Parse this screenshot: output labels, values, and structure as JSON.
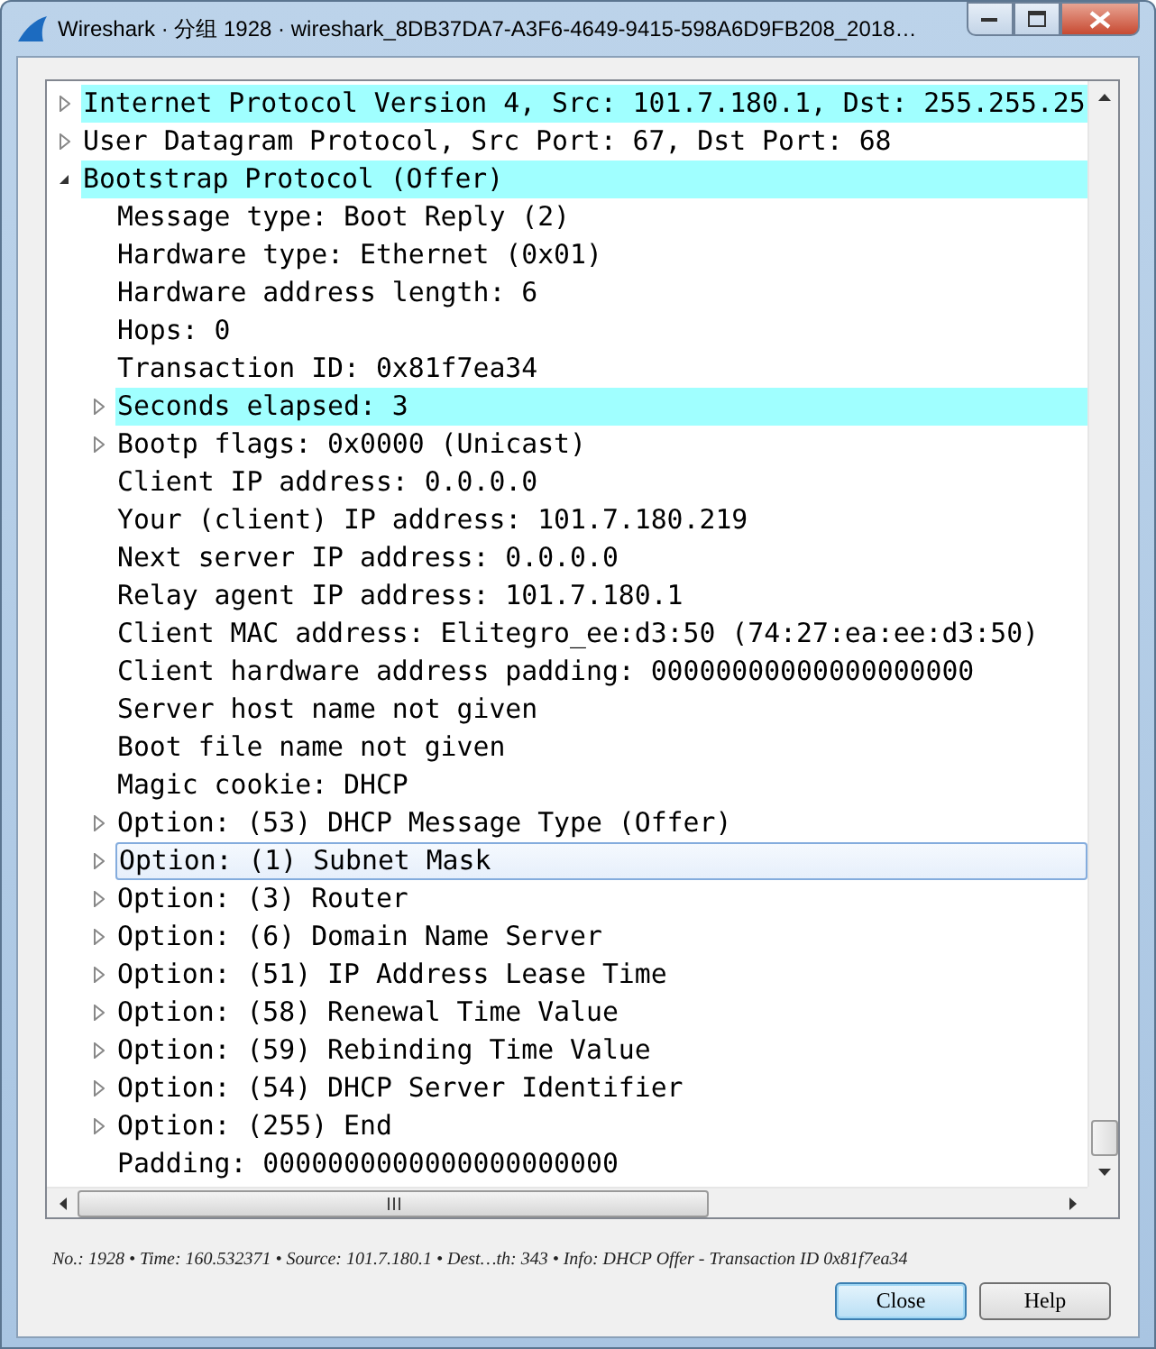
{
  "window": {
    "title": "Wireshark · 分组 1928 · wireshark_8DB37DA7-A3F6-4649-9415-598A6D9FB208_2018…"
  },
  "tree": [
    {
      "kind": "branch",
      "label": "Internet Protocol Version 4, Src: 101.7.180.1, Dst: 255.255.25",
      "expanded": false,
      "highlighted": true,
      "selected": false
    },
    {
      "kind": "branch",
      "label": "User Datagram Protocol, Src Port: 67, Dst Port: 68",
      "expanded": false,
      "highlighted": false,
      "selected": false
    },
    {
      "kind": "branch",
      "label": "Bootstrap Protocol (Offer)",
      "expanded": true,
      "highlighted": true,
      "selected": false,
      "children": [
        {
          "kind": "leaf",
          "label": "Message type: Boot Reply (2)",
          "highlighted": false,
          "selected": false
        },
        {
          "kind": "leaf",
          "label": "Hardware type: Ethernet (0x01)",
          "highlighted": false,
          "selected": false
        },
        {
          "kind": "leaf",
          "label": "Hardware address length: 6",
          "highlighted": false,
          "selected": false
        },
        {
          "kind": "leaf",
          "label": "Hops: 0",
          "highlighted": false,
          "selected": false
        },
        {
          "kind": "leaf",
          "label": "Transaction ID: 0x81f7ea34",
          "highlighted": false,
          "selected": false
        },
        {
          "kind": "branch",
          "label": "Seconds elapsed: 3",
          "expanded": false,
          "highlighted": true,
          "selected": false
        },
        {
          "kind": "branch",
          "label": "Bootp flags: 0x0000 (Unicast)",
          "expanded": false,
          "highlighted": false,
          "selected": false
        },
        {
          "kind": "leaf",
          "label": "Client IP address: 0.0.0.0",
          "highlighted": false,
          "selected": false
        },
        {
          "kind": "leaf",
          "label": "Your (client) IP address: 101.7.180.219",
          "highlighted": false,
          "selected": false
        },
        {
          "kind": "leaf",
          "label": "Next server IP address: 0.0.0.0",
          "highlighted": false,
          "selected": false
        },
        {
          "kind": "leaf",
          "label": "Relay agent IP address: 101.7.180.1",
          "highlighted": false,
          "selected": false
        },
        {
          "kind": "leaf",
          "label": "Client MAC address: Elitegro_ee:d3:50 (74:27:ea:ee:d3:50)",
          "highlighted": false,
          "selected": false
        },
        {
          "kind": "leaf",
          "label": "Client hardware address padding: 00000000000000000000",
          "highlighted": false,
          "selected": false
        },
        {
          "kind": "leaf",
          "label": "Server host name not given",
          "highlighted": false,
          "selected": false
        },
        {
          "kind": "leaf",
          "label": "Boot file name not given",
          "highlighted": false,
          "selected": false
        },
        {
          "kind": "leaf",
          "label": "Magic cookie: DHCP",
          "highlighted": false,
          "selected": false
        },
        {
          "kind": "branch",
          "label": "Option: (53) DHCP Message Type (Offer)",
          "expanded": false,
          "highlighted": false,
          "selected": false
        },
        {
          "kind": "branch",
          "label": "Option: (1) Subnet Mask",
          "expanded": false,
          "highlighted": false,
          "selected": true
        },
        {
          "kind": "branch",
          "label": "Option: (3) Router",
          "expanded": false,
          "highlighted": false,
          "selected": false
        },
        {
          "kind": "branch",
          "label": "Option: (6) Domain Name Server",
          "expanded": false,
          "highlighted": false,
          "selected": false
        },
        {
          "kind": "branch",
          "label": "Option: (51) IP Address Lease Time",
          "expanded": false,
          "highlighted": false,
          "selected": false
        },
        {
          "kind": "branch",
          "label": "Option: (58) Renewal Time Value",
          "expanded": false,
          "highlighted": false,
          "selected": false
        },
        {
          "kind": "branch",
          "label": "Option: (59) Rebinding Time Value",
          "expanded": false,
          "highlighted": false,
          "selected": false
        },
        {
          "kind": "branch",
          "label": "Option: (54) DHCP Server Identifier",
          "expanded": false,
          "highlighted": false,
          "selected": false
        },
        {
          "kind": "branch",
          "label": "Option: (255) End",
          "expanded": false,
          "highlighted": false,
          "selected": false
        },
        {
          "kind": "leaf",
          "label": "Padding: 0000000000000000000000",
          "highlighted": false,
          "selected": false
        }
      ]
    }
  ],
  "status_line": "No.: 1928 • Time: 160.532371 • Source: 101.7.180.1 • Dest…th: 343 • Info: DHCP Offer - Transaction ID 0x81f7ea34",
  "buttons": [
    {
      "label": "Close",
      "default": true
    },
    {
      "label": "Help",
      "default": false
    }
  ]
}
